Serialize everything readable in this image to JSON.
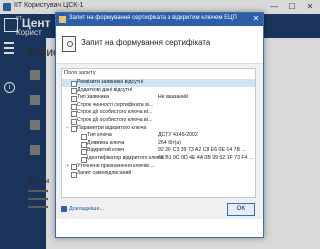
{
  "main_window": {
    "title": "IIT Користувач ЦСК-1",
    "brand": "Цент",
    "brand_prefix": "IIT",
    "brand_sub": "Корист",
    "content_title": "Корис",
    "bottom_label": "Допом"
  },
  "dialog": {
    "title": "Запит на формування сертифіката з відкритим ключем ЕЦП",
    "heading": "Запит на формування сертифіката",
    "fields_header": "Поля запиту",
    "rows": [
      {
        "label": "Реквізити заявника відсутні",
        "value": "",
        "indent": 0,
        "expander": "",
        "selected": true
      },
      {
        "label": "Додаткові дані відсутні",
        "value": "",
        "indent": 0,
        "expander": "",
        "selected": false
      },
      {
        "label": "Тип заявника",
        "value": "Не вказаний",
        "indent": 0,
        "expander": "",
        "selected": false
      },
      {
        "label": "Строк чинності сертифіката ві...",
        "value": "",
        "indent": 0,
        "expander": "",
        "selected": false
      },
      {
        "label": "Строк дії особистого ключа ві...",
        "value": "",
        "indent": 0,
        "expander": "",
        "selected": false
      },
      {
        "label": "Строк дії особистого ключа ві...",
        "value": "",
        "indent": 0,
        "expander": "",
        "selected": false
      },
      {
        "label": "Параметри відкритого ключа",
        "value": "",
        "indent": 0,
        "expander": "−",
        "selected": false
      },
      {
        "label": "Тип ключа",
        "value": "ДСТУ 4145-2002",
        "indent": 1,
        "expander": "",
        "selected": false
      },
      {
        "label": "Довжина ключа",
        "value": "264 біт(а)",
        "indent": 1,
        "expander": "",
        "selected": false
      },
      {
        "label": "Відкритий ключ",
        "value": "92 2F C3 39 73 A2 C8 E6 0E 14 7B ...",
        "indent": 1,
        "expander": "",
        "selected": false
      },
      {
        "label": "Ідентифікатор відкритого ключа",
        "value": "69 B1 9C 0D 4E 4A 0B 99 52 1F 73 F4 ...",
        "indent": 1,
        "expander": "",
        "selected": false
      },
      {
        "label": "Уточнене призначення ключів ...",
        "value": "",
        "indent": 0,
        "expander": "+",
        "selected": false
      },
      {
        "label": "Запит самопідписаний",
        "value": "",
        "indent": 0,
        "expander": "",
        "selected": false
      }
    ],
    "details_link": "Докладніше...",
    "ok_label": "OK"
  }
}
